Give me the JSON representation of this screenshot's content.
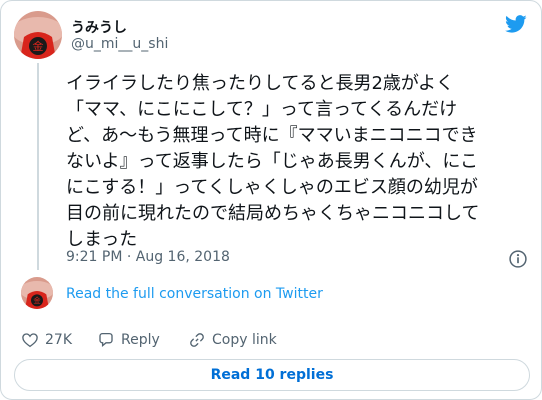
{
  "user": {
    "display_name": "うみうし",
    "handle": "@u_mi__u_shi"
  },
  "tweet": {
    "text": "イライラしたり焦ったりしてると長男2歳がよく\n「ママ、にこにこして？」って言ってくるんだけ\nど、あ〜もう無理って時に『ママいまニコニコでき\nないよ』って返事したら「じゃあ長男くんが、にこ\nにこする！」ってくしゃくしゃのエビス顔の幼児が\n目の前に現れたので結局めちゃくちゃニコニコして\nしまった",
    "timestamp": "9:21 PM · Aug 16, 2018"
  },
  "conversation_link": "Read the full conversation on Twitter",
  "actions": {
    "like_count": "27K",
    "reply_label": "Reply",
    "copy_label": "Copy link"
  },
  "read_replies_label": "Read 10 replies",
  "icons": {
    "brand": "twitter-bird-icon",
    "info": "info-icon",
    "like": "heart-icon",
    "reply": "speech-bubble-icon",
    "copy": "link-icon"
  },
  "colors": {
    "accent": "#1d9bf0",
    "link_button": "#006fd6",
    "muted": "#536471",
    "border": "#cfd9de"
  }
}
